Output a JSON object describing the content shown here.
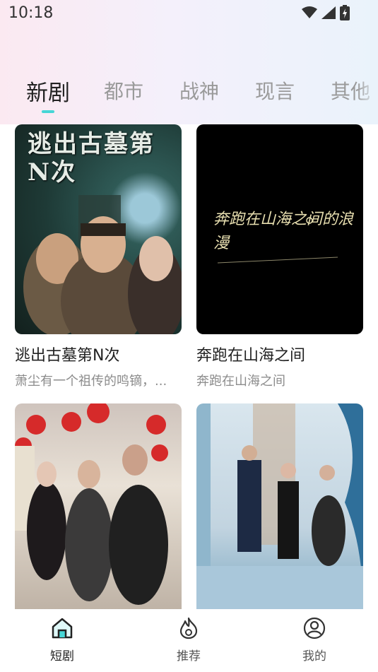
{
  "status": {
    "time": "10:18"
  },
  "tabs": [
    {
      "label": "新剧",
      "active": true
    },
    {
      "label": "都市",
      "active": false
    },
    {
      "label": "战神",
      "active": false
    },
    {
      "label": "现言",
      "active": false
    },
    {
      "label": "其他",
      "active": false
    }
  ],
  "cards": [
    {
      "title": "逃出古墓第N次",
      "desc": "萧尘有一个祖传的鸣镝，...",
      "poster_text": "逃出古墓第N次"
    },
    {
      "title": "奔跑在山海之间",
      "desc": "奔跑在山海之间",
      "poster_text": "奔跑在山海之间的浪漫"
    },
    {
      "title": "",
      "desc": ""
    },
    {
      "title": "",
      "desc": ""
    }
  ],
  "nav": [
    {
      "label": "短剧",
      "icon": "home-icon",
      "active": true
    },
    {
      "label": "推荐",
      "icon": "flame-icon",
      "active": false
    },
    {
      "label": "我的",
      "icon": "user-icon",
      "active": false
    }
  ],
  "colors": {
    "accent": "#46d6d6"
  }
}
